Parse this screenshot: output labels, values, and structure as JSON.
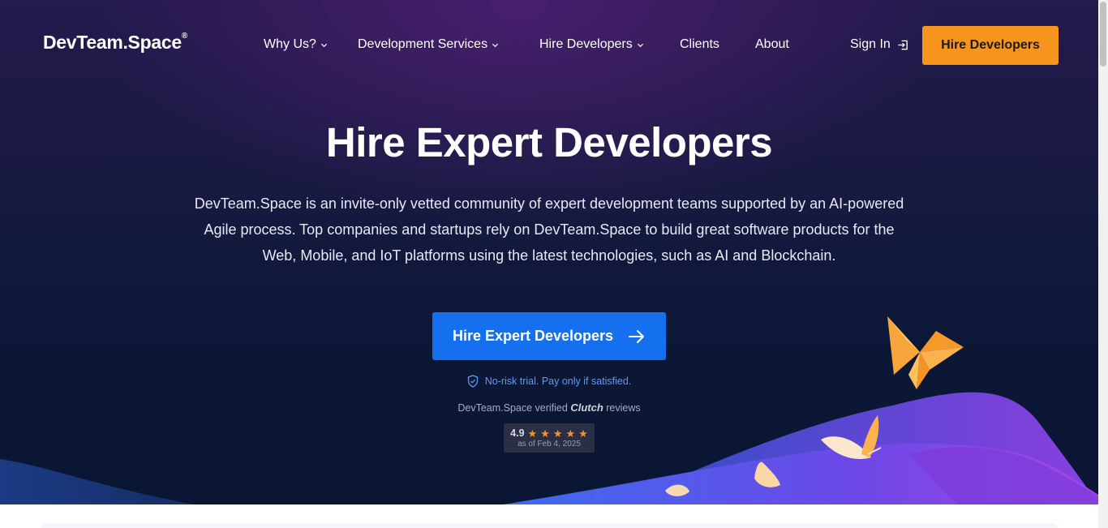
{
  "brand": {
    "name": "DevTeam.Space",
    "mark": "®"
  },
  "nav": {
    "items": [
      {
        "label": "Why Us?",
        "dropdown": true
      },
      {
        "label": "Development Services",
        "dropdown": true
      },
      {
        "label": "Hire Developers",
        "dropdown": true
      },
      {
        "label": "Clients",
        "dropdown": false
      },
      {
        "label": "About",
        "dropdown": false
      }
    ],
    "sign_in": "Sign In",
    "cta": "Hire Developers"
  },
  "hero": {
    "title": "Hire Expert Developers",
    "description_lines": [
      "DevTeam.Space is an invite-only vetted community of expert development teams supported by an AI-powered",
      "Agile process. Top companies and startups rely on DevTeam.Space to build great software products for the",
      "Web, Mobile, and IoT platforms using the latest technologies, such as AI and Blockchain."
    ],
    "cta": "Hire Expert Developers",
    "trial_note": "No-risk trial. Pay only if satisfied.",
    "clutch": {
      "prefix": "DevTeam.Space verified",
      "brand": "Clutch",
      "suffix": "reviews",
      "score": "4.9",
      "stars": 5,
      "date": "as of Feb 4, 2025"
    }
  },
  "icons": {
    "chevron": "chevron-down-icon",
    "sign_in": "sign-in-icon",
    "arrow": "arrow-right-icon",
    "shield": "shield-check-icon",
    "star": "star-icon"
  },
  "colors": {
    "accent_orange": "#f7941d",
    "cta_blue": "#1570ef",
    "trial_blue": "#5e9bf6",
    "hero_bg": "#0c1736"
  }
}
